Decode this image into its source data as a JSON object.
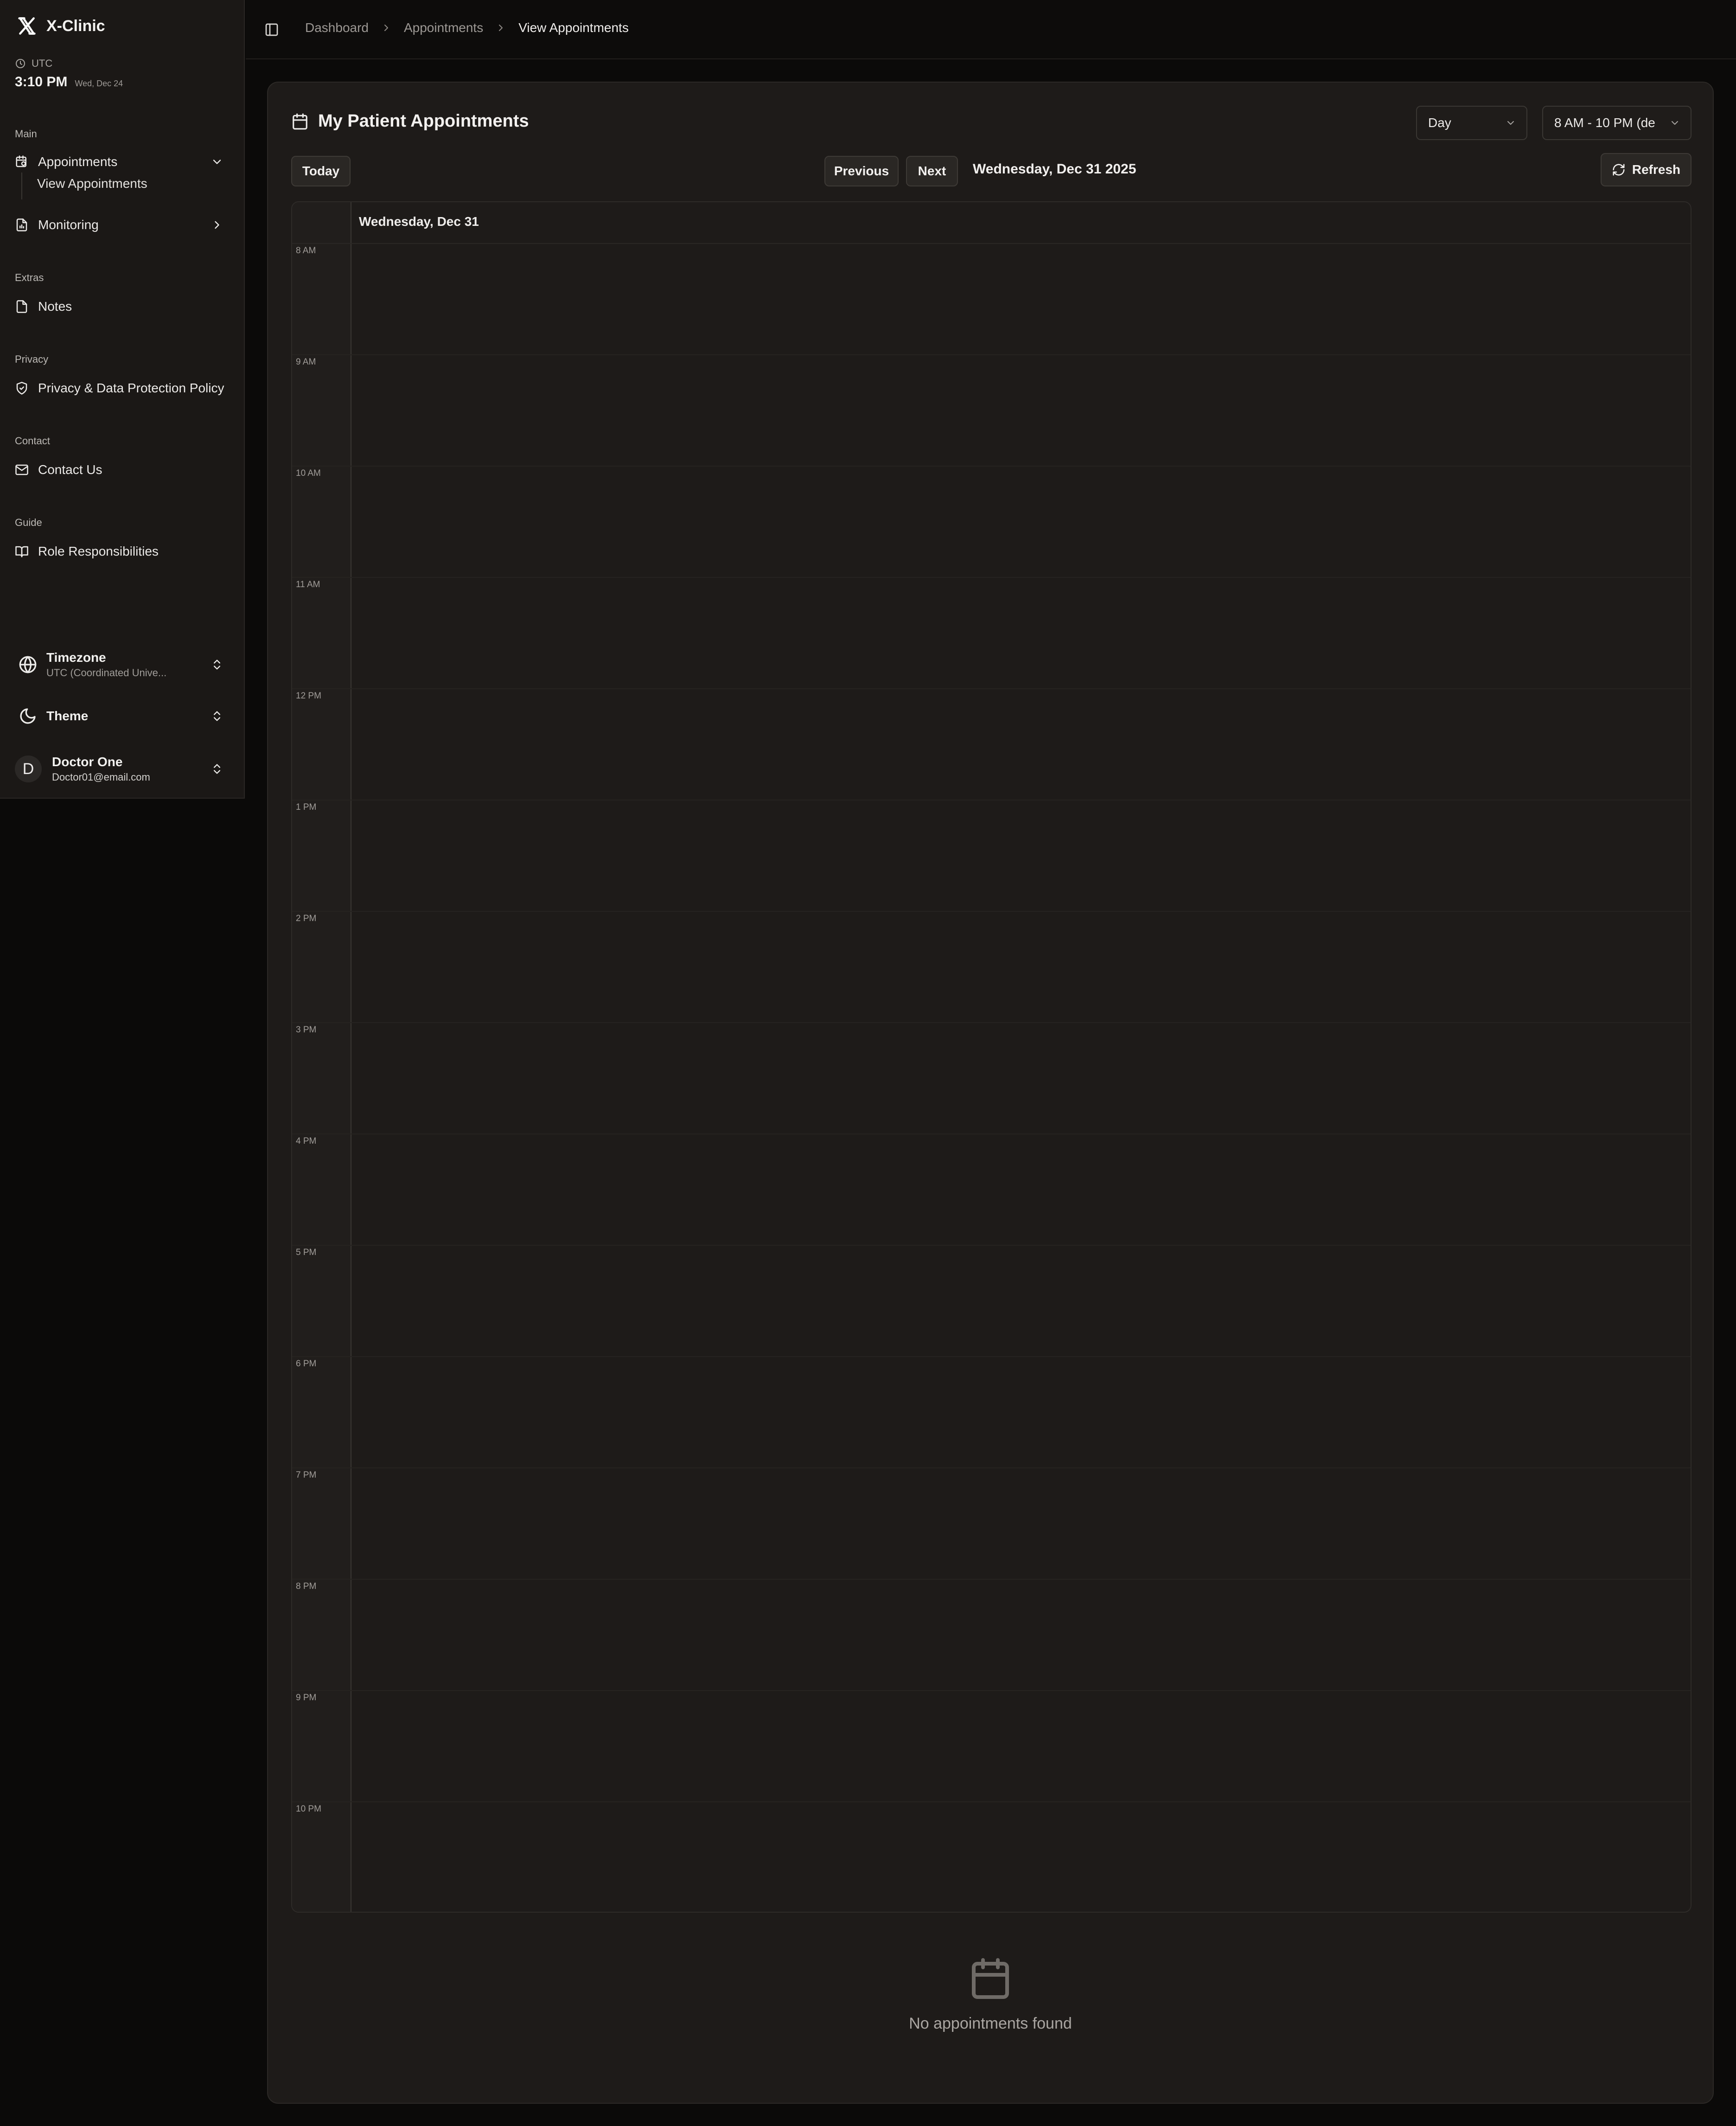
{
  "app": {
    "name": "X-Clinic",
    "logo_icon": "x-logo-icon"
  },
  "clock": {
    "timezone": "UTC",
    "time": "3:10 PM",
    "date": "Wed, Dec 24"
  },
  "sidebar": {
    "groups": {
      "main": "Main",
      "extras": "Extras",
      "privacy": "Privacy",
      "contact": "Contact",
      "guide": "Guide"
    },
    "items": {
      "appointments": "Appointments",
      "view_appointments": "View Appointments",
      "monitoring": "Monitoring",
      "notes": "Notes",
      "privacy_policy": "Privacy & Data Protection Policy",
      "contact_us": "Contact Us",
      "role_responsibilities": "Role Responsibilities"
    },
    "footer": {
      "timezone_title": "Timezone",
      "timezone_value": "UTC (Coordinated Unive...",
      "theme_title": "Theme",
      "user_initial": "D",
      "user_name": "Doctor One",
      "user_email": "Doctor01@email.com"
    }
  },
  "breadcrumb": [
    "Dashboard",
    "Appointments",
    "View Appointments"
  ],
  "card": {
    "title": "My Patient Appointments",
    "view_select": "Day",
    "hours_select": "8 AM - 10 PM (de",
    "today_button": "Today",
    "previous_button": "Previous",
    "next_button": "Next",
    "current_date": "Wednesday, Dec 31 2025",
    "refresh_button": "Refresh"
  },
  "calendar": {
    "day_header": "Wednesday, Dec 31",
    "hours": [
      "8 AM",
      "9 AM",
      "10 AM",
      "11 AM",
      "12 PM",
      "1 PM",
      "2 PM",
      "3 PM",
      "4 PM",
      "5 PM",
      "6 PM",
      "7 PM",
      "8 PM",
      "9 PM",
      "10 PM"
    ]
  },
  "empty_state": {
    "message": "No appointments found",
    "icon": "calendar-icon"
  },
  "colors": {
    "background": "#0b0a09",
    "sidebar": "#1b1816",
    "card": "#1e1b19",
    "text": "#ecebe9",
    "muted": "#9c9894"
  }
}
